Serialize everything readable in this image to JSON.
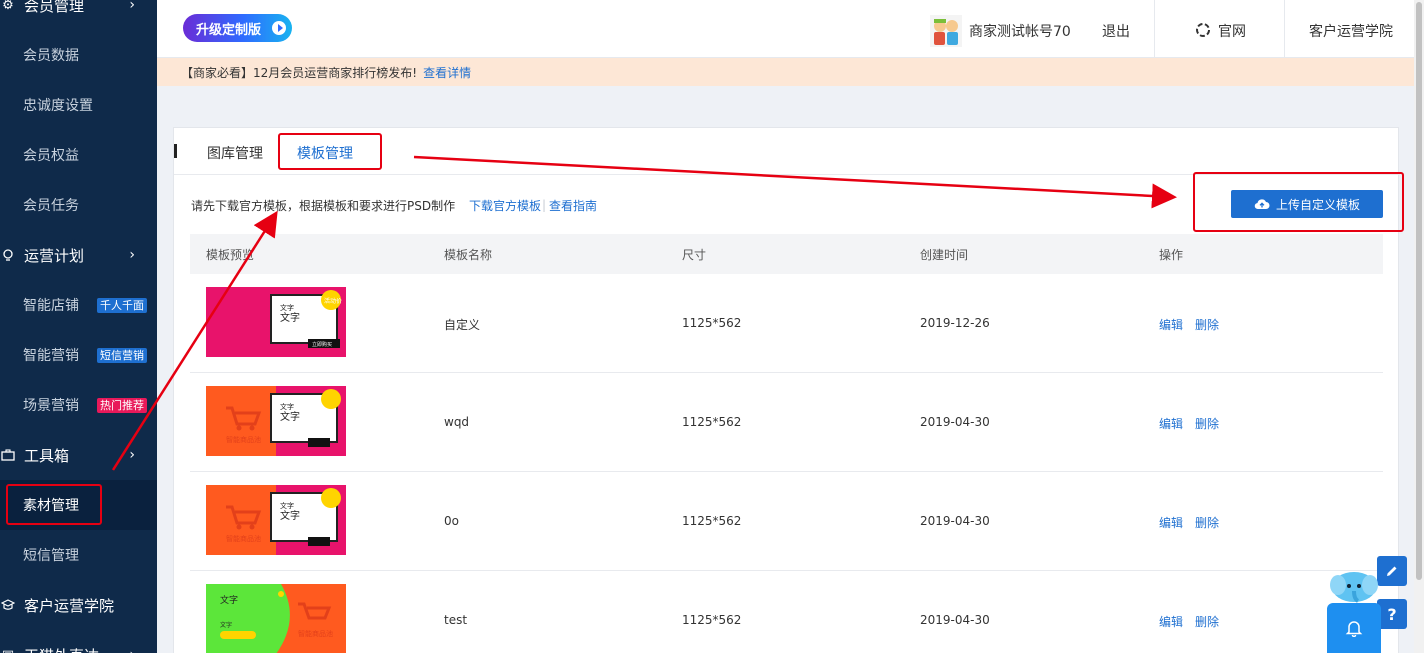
{
  "sidebar": {
    "member_mgmt": "会员管理",
    "member_data": "会员数据",
    "loyalty": "忠诚度设置",
    "rights": "会员权益",
    "tasks": "会员任务",
    "ops_plan": "运营计划",
    "smart_store": "智能店铺",
    "smart_store_badge": "千人千面",
    "smart_marketing": "智能营销",
    "smart_marketing_badge": "短信营销",
    "scene_marketing": "场景营销",
    "scene_marketing_badge": "热门推荐",
    "toolbox": "工具箱",
    "material_mgmt": "素材管理",
    "sms_mgmt": "短信管理",
    "academy": "客户运营学院",
    "tmall_partial": "天猫外直达"
  },
  "header": {
    "upgrade_label": "升级定制版",
    "account": "商家测试帐号70",
    "logout": "退出",
    "official_site": "官网",
    "academy": "客户运营学院"
  },
  "notice": {
    "text": "【商家必看】12月会员运营商家排行榜发布!",
    "link": "查看详情"
  },
  "tabs": {
    "gallery": "图库管理",
    "templates": "模板管理"
  },
  "hint": {
    "text": "请先下载官方模板，根据模板和要求进行PSD制作",
    "download_link": "下载官方模板",
    "separator": "|",
    "guide_link": "查看指南"
  },
  "upload_button": "上传自定义模板",
  "table": {
    "headers": {
      "preview": "模板预览",
      "name": "模板名称",
      "size": "尺寸",
      "created": "创建时间",
      "actions": "操作"
    },
    "edit_label": "编辑",
    "delete_label": "删除",
    "rows": [
      {
        "name": "自定义",
        "size": "1125*562",
        "created": "2019-12-26"
      },
      {
        "name": "wqd",
        "size": "1125*562",
        "created": "2019-04-30"
      },
      {
        "name": "0o",
        "size": "1125*562",
        "created": "2019-04-30"
      },
      {
        "name": "test",
        "size": "1125*562",
        "created": "2019-04-30"
      }
    ]
  },
  "thumb_text": {
    "word": "文字",
    "cart_caption": "智能商品池",
    "badge_text": "活动价",
    "small_label": "立即购买"
  },
  "widgets": {
    "help_label": "?"
  },
  "colors": {
    "sidebar_bg": "#0f2a4a",
    "accent": "#1e6fd0",
    "annotation_red": "#e60012",
    "badge_blue": "#1e6fd0",
    "badge_pink": "#e8195a",
    "notice_bg": "#fde7d6"
  }
}
